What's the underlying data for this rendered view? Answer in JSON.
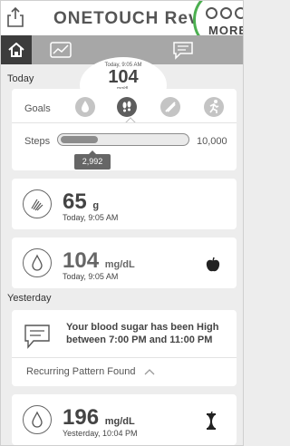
{
  "app": {
    "title": "ONETOUCH Reveal",
    "more_label": "MORE"
  },
  "nav": {
    "latest_time": "Today, 9:05 AM",
    "latest_value": "104",
    "latest_unit": "mg/dL"
  },
  "today": {
    "label": "Today",
    "goals_label": "Goals",
    "goal_icons": [
      "glucose-drop-icon",
      "footsteps-icon",
      "food-icon",
      "activity-runner-icon"
    ],
    "steps_label": "Steps",
    "steps_goal": "10,000",
    "steps_value": "2,992",
    "steps_fraction": 0.2992,
    "carbs": {
      "value": "65",
      "unit": "g",
      "time": "Today, 9:05 AM"
    },
    "glucose": {
      "value": "104",
      "unit": "mg/dL",
      "time": "Today, 9:05 AM"
    }
  },
  "yesterday": {
    "label": "Yesterday",
    "insight_text": "Your blood sugar has been High between 7:00 PM and 11:00 PM",
    "recurring_label": "Recurring Pattern Found",
    "glucose": {
      "value": "196",
      "unit": "mg/dL",
      "time": "Yesterday, 10:04 PM"
    }
  }
}
